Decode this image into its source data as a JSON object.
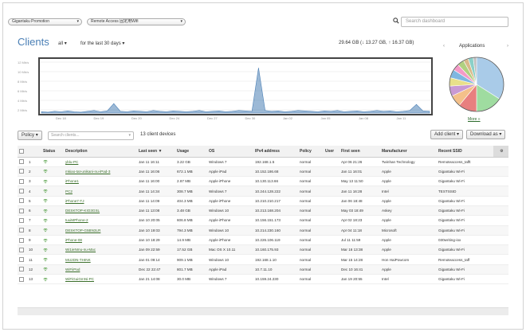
{
  "filters": {
    "network_label": "Gigantaku Promotion",
    "ssid_label": "Remote Access 固定用Wifi"
  },
  "search": {
    "placeholder": "Search dashboard"
  },
  "clients_header": {
    "title": "Clients",
    "filter_all": "all",
    "range_label": "for the last 30 days",
    "usage_summary": "29.64 GB (↓ 13.27 GB, ↑ 16.37 GB)"
  },
  "chart_data": {
    "type": "area",
    "title": "",
    "xlabel": "",
    "ylabel": "",
    "y_ticks": [
      "12 Mb/s",
      "10 Mb/s",
      "8 Mb/s",
      "6 Mb/s",
      "4 Mb/s",
      "2 Mb/s"
    ],
    "x_ticks": [
      "Dec 18",
      "Dec 19",
      "Dec 20",
      "Dec 24",
      "Dec 27",
      "Dec 30",
      "Jan 02",
      "Jan 05",
      "Jan 08",
      "Jan 11"
    ],
    "ylim": [
      0,
      12
    ],
    "color": "#4a7fb5",
    "x": [
      0,
      1,
      2,
      3,
      4,
      5,
      6,
      7,
      8,
      9,
      10,
      11,
      12,
      13,
      14,
      15,
      16,
      17,
      18,
      19,
      20,
      21,
      22,
      23,
      24,
      25,
      26,
      27,
      28,
      29,
      30,
      31,
      32,
      33,
      34,
      35,
      36,
      37,
      38,
      39,
      40,
      41,
      42,
      43,
      44,
      45,
      46,
      47,
      48,
      49,
      50,
      51,
      52,
      53,
      54,
      55,
      56,
      57,
      58,
      59
    ],
    "values": [
      0.3,
      0.2,
      0.4,
      0.3,
      0.5,
      0.3,
      0.2,
      0.4,
      0.6,
      0.3,
      0.5,
      2.2,
      0.4,
      0.3,
      0.5,
      0.4,
      0.3,
      0.6,
      0.4,
      0.3,
      0.5,
      0.4,
      0.3,
      0.4,
      0.6,
      0.3,
      0.4,
      0.5,
      0.3,
      0.4,
      0.6,
      0.5,
      0.4,
      10.5,
      0.6,
      0.4,
      0.5,
      0.3,
      0.4,
      0.6,
      0.5,
      0.4,
      0.3,
      0.5,
      0.4,
      0.6,
      0.3,
      0.4,
      0.5,
      0.3,
      0.4,
      0.6,
      0.4,
      0.5,
      0.3,
      0.4,
      0.6,
      2.0,
      0.5,
      0.4
    ]
  },
  "applications": {
    "title": "Applications",
    "more_label": "More »",
    "prev": "‹",
    "next": "›",
    "slices": [
      {
        "value": 34,
        "color": "#a9cbe8"
      },
      {
        "value": 16,
        "color": "#9fdca0"
      },
      {
        "value": 11,
        "color": "#e87f7f"
      },
      {
        "value": 7,
        "color": "#f4c08a"
      },
      {
        "value": 6,
        "color": "#c99ad4"
      },
      {
        "value": 5,
        "color": "#e8e08a"
      },
      {
        "value": 5,
        "color": "#7fb7e0"
      },
      {
        "value": 4,
        "color": "#f49ac7"
      },
      {
        "value": 4,
        "color": "#b0d080"
      },
      {
        "value": 3,
        "color": "#d9b98a"
      },
      {
        "value": 3,
        "color": "#8ad0c8"
      },
      {
        "value": 2,
        "color": "#c0c0c0"
      }
    ]
  },
  "toolbar": {
    "policy_label": "Policy",
    "search_placeholder": "Search clients...",
    "count_label": "13 client devices",
    "add_client_label": "Add client",
    "download_label": "Download as"
  },
  "table": {
    "columns": [
      "",
      "",
      "Status",
      "Description",
      "Last seen ▼",
      "Usage",
      "OS",
      "IPv4 address",
      "Policy",
      "User",
      "First seen",
      "Manufacturer",
      "Recent SSID",
      ""
    ],
    "rows": [
      [
        "1",
        "yblu-PC",
        "Jan 11 16:11",
        "3.22 GB",
        "Windows 7",
        "192.168.1.5",
        "normal",
        "",
        "Apr 06 21:26",
        "Twinhan Technology",
        "Remoteaccess_tafft"
      ],
      [
        "2",
        "mkiao-tat-unikani-nu-iPad-3",
        "Jan 11 16:06",
        "672.1 MB",
        "Apple iPad",
        "10.152.186.68",
        "normal",
        "",
        "Jan 11 16:01",
        "Apple",
        "Gigantaku Wi-Fi"
      ],
      [
        "3",
        "iPhone1",
        "Jan 11 16:00",
        "2.87 MB",
        "Apple iPhone",
        "10.130.113.66",
        "normal",
        "",
        "May 13 11:50",
        "Apple",
        "Gigantaku Wi-Fi"
      ],
      [
        "4",
        "PC2",
        "Jan 11 14:34",
        "308.7 MB",
        "Windows 7",
        "10.244.128.222",
        "normal",
        "",
        "Jan 11 16:28",
        "Intel",
        "TESTSSID"
      ],
      [
        "5",
        "iPhone7-TJ",
        "Jan 11 14:09",
        "404.3 MB",
        "Apple iPhone",
        "10.210.210.217",
        "normal",
        "",
        "Jan 06 18:48",
        "Apple",
        "Gigantaku Wi-Fi"
      ],
      [
        "6",
        "DESKTOP-KIO3GSL",
        "Jan 11 13:08",
        "3.48 GB",
        "Windows 10",
        "10.213.168.204",
        "normal",
        "",
        "May 03 18:49",
        "Askey",
        "Gigantaku Wi-Fi"
      ],
      [
        "7",
        "tuuiMPhone-2",
        "Jan 10 20:05",
        "606.8 MB",
        "Apple iPhone",
        "10.156.151.173",
        "normal",
        "",
        "Apr 02 18:23",
        "Apple",
        "Gigantaku Wi-Fi"
      ],
      [
        "8",
        "DESKTOP-G5BN3LR",
        "Jan 10 19:03",
        "794.3 MB",
        "Windows 10",
        "10.214.230.160",
        "normal",
        "",
        "Apr 04 11:18",
        "Microsoft",
        "Gigantaku Wi-Fi"
      ],
      [
        "9",
        "iPhone-08",
        "Jan 10 18:29",
        "14.9 MB",
        "Apple iPhone",
        "10.226.106.119",
        "normal",
        "",
        "Jul 11 11:59",
        "Apple",
        "030writing-iox"
      ],
      [
        "10",
        "Wi1ieNmu-nu-Mac",
        "Jan 09 22:59",
        "17.52 GB",
        "Mac OS X 10.11",
        "10.160.175.93",
        "normal",
        "",
        "Mar 16 13:38",
        "Apple",
        "Gigantaku Wi-Fi"
      ],
      [
        "11",
        "MU2DN-THINK",
        "Jan 01 09:14",
        "909.1 MB",
        "Windows 10",
        "192.168.1.10",
        "normal",
        "",
        "Mar 15 14:28",
        "Hon HaiPowcom",
        "Remoteaccess_taff"
      ],
      [
        "12",
        "WiFiiPad",
        "Dec 22 22:47",
        "801.7 MB",
        "Apple iPad",
        "10.7.11.10",
        "normal",
        "",
        "Dec 10 16:41",
        "Apple",
        "Gigantaku Wi-Fi"
      ],
      [
        "13",
        "WiFiGuiGmNi-PC",
        "Jan 21 14:08",
        "30.0 MB",
        "Windows 7",
        "10.159.24.230",
        "normal",
        "",
        "Jan 19 20:55",
        "Intel",
        "Gigantaku Wi-Fi"
      ]
    ]
  }
}
